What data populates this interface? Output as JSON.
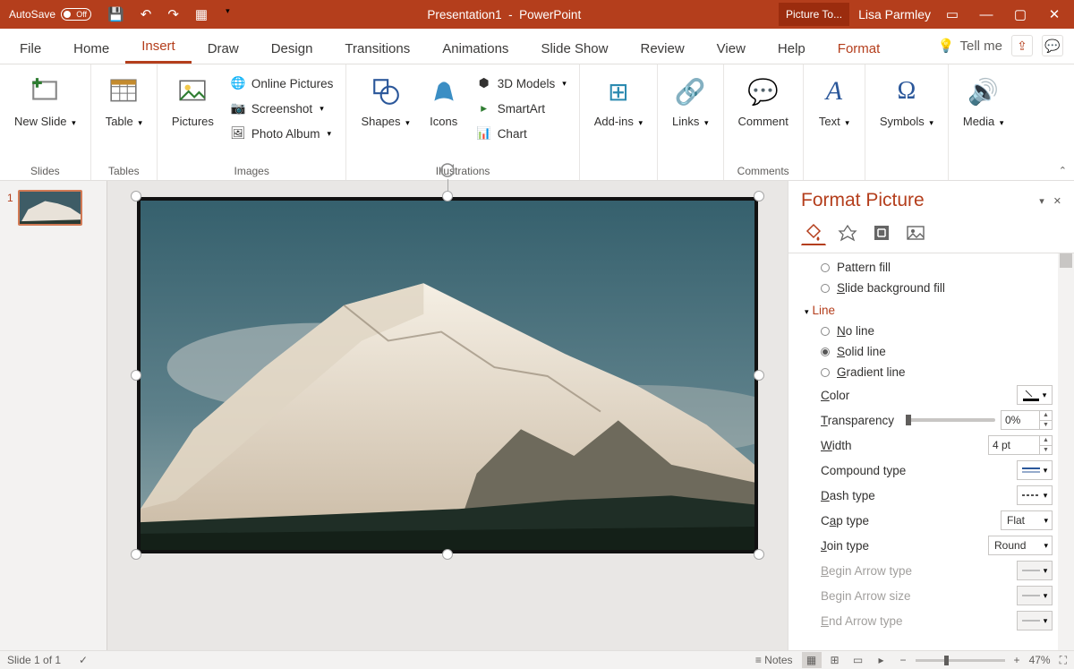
{
  "titlebar": {
    "autosave_label": "AutoSave",
    "autosave_state": "Off",
    "doc_title": "Presentation1",
    "app_name": "PowerPoint",
    "context_tab": "Picture To...",
    "user": "Lisa Parmley"
  },
  "ribbon_tabs": [
    "File",
    "Home",
    "Insert",
    "Draw",
    "Design",
    "Transitions",
    "Animations",
    "Slide Show",
    "Review",
    "View",
    "Help",
    "Format"
  ],
  "active_tab": "Insert",
  "tellme": "Tell me",
  "ribbon": {
    "slides": {
      "new_slide": "New Slide",
      "group": "Slides"
    },
    "tables": {
      "table": "Table",
      "group": "Tables"
    },
    "images": {
      "pictures": "Pictures",
      "online": "Online Pictures",
      "screenshot": "Screenshot",
      "album": "Photo Album",
      "group": "Images"
    },
    "illustrations": {
      "shapes": "Shapes",
      "icons": "Icons",
      "models": "3D Models",
      "smartart": "SmartArt",
      "chart": "Chart",
      "group": "Illustrations"
    },
    "addins": {
      "btn": "Add-ins",
      "group": ""
    },
    "links": {
      "btn": "Links",
      "group": ""
    },
    "comments": {
      "btn": "Comment",
      "group": "Comments"
    },
    "text": {
      "btn": "Text"
    },
    "symbols": {
      "btn": "Symbols"
    },
    "media": {
      "btn": "Media"
    }
  },
  "thumb": {
    "num": "1"
  },
  "pane": {
    "title": "Format Picture",
    "fill": {
      "pattern": "Pattern fill",
      "slidebg": "Slide background fill"
    },
    "line": {
      "header": "Line",
      "no_line": "No line",
      "solid": "Solid line",
      "gradient": "Gradient line",
      "color": "Color",
      "transparency": "Transparency",
      "transparency_val": "0%",
      "width": "Width",
      "width_val": "4 pt",
      "compound": "Compound type",
      "dash": "Dash type",
      "cap": "Cap type",
      "cap_val": "Flat",
      "join": "Join type",
      "join_val": "Round",
      "begin_arrow_type": "Begin Arrow type",
      "begin_arrow_size": "Begin Arrow size",
      "end_arrow_type": "End Arrow type"
    }
  },
  "status": {
    "slide": "Slide 1 of 1",
    "notes": "Notes",
    "zoom": "47%"
  }
}
